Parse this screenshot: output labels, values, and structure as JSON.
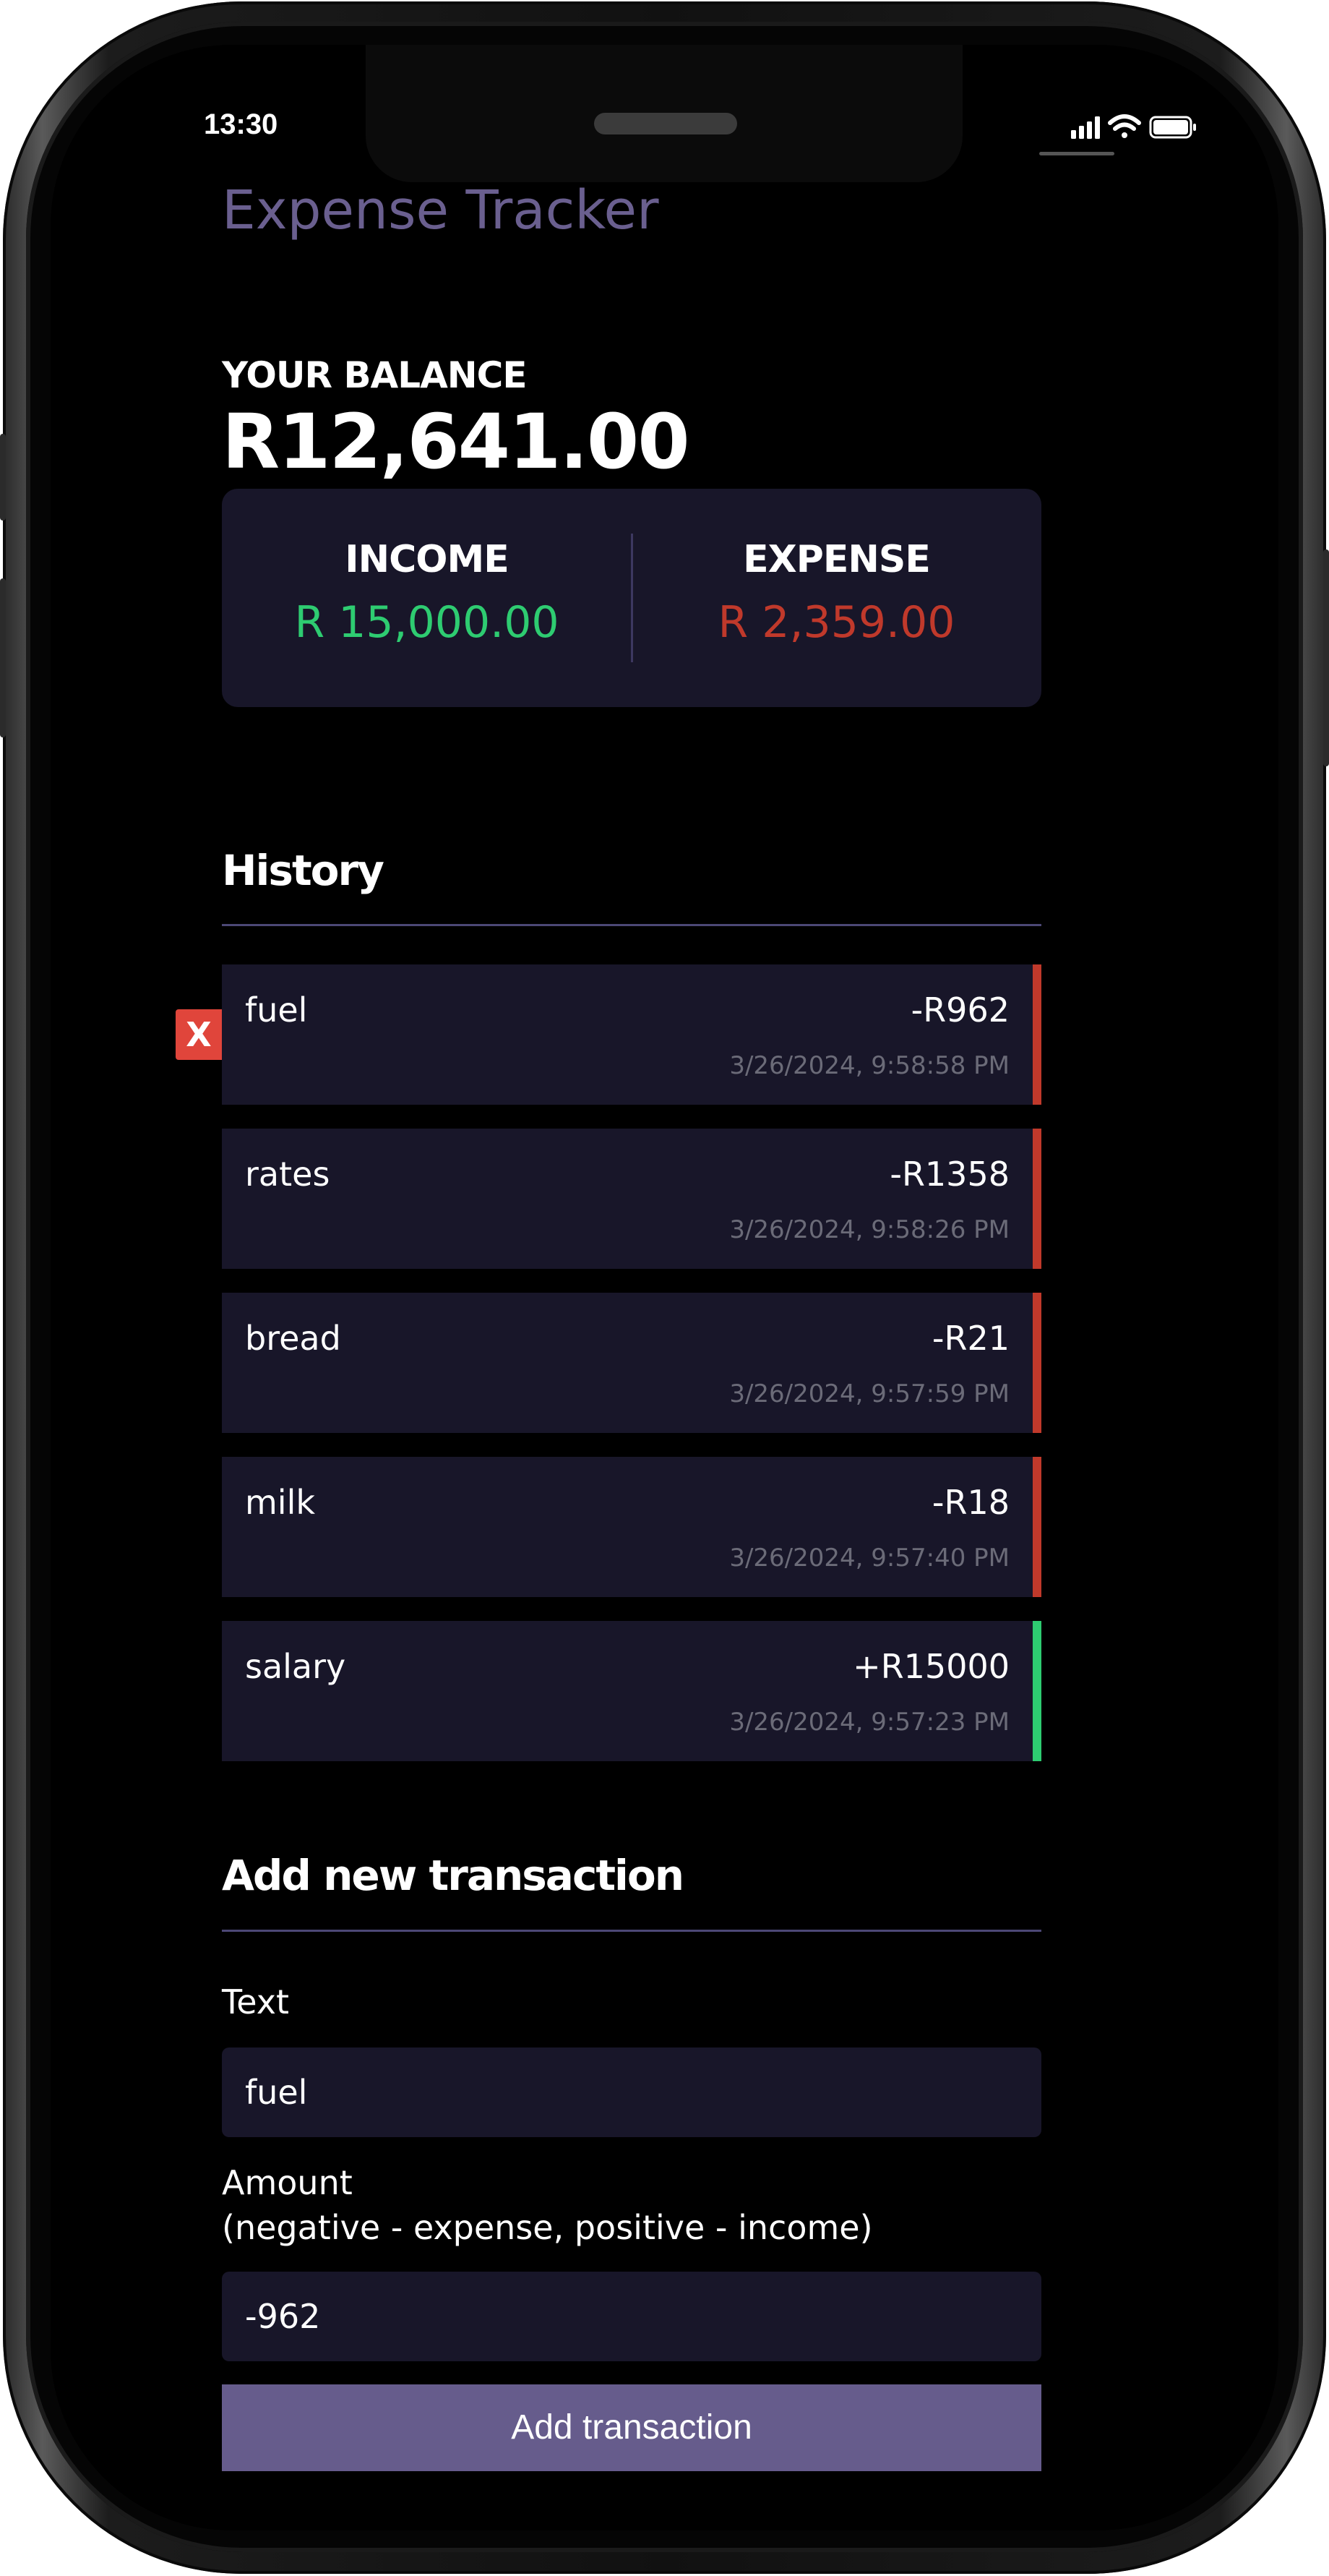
{
  "status_bar": {
    "time": "13:30"
  },
  "app": {
    "title": "Expense Tracker"
  },
  "balance": {
    "label": "YOUR BALANCE",
    "value": "R12,641.00"
  },
  "summary": {
    "income_label": "INCOME",
    "income_value": "R 15,000.00",
    "expense_label": "EXPENSE",
    "expense_value": "R 2,359.00"
  },
  "colors": {
    "income": "#2ecc71",
    "expense": "#c0392b",
    "accent": "#665c8c",
    "delete": "#e0453b"
  },
  "history": {
    "title": "History",
    "delete_label": "X",
    "transactions": [
      {
        "text": "fuel",
        "amount": "-R962",
        "date": "3/26/2024, 9:58:58 PM",
        "type": "expense"
      },
      {
        "text": "rates",
        "amount": "-R1358",
        "date": "3/26/2024, 9:58:26 PM",
        "type": "expense"
      },
      {
        "text": "bread",
        "amount": "-R21",
        "date": "3/26/2024, 9:57:59 PM",
        "type": "expense"
      },
      {
        "text": "milk",
        "amount": "-R18",
        "date": "3/26/2024, 9:57:40 PM",
        "type": "expense"
      },
      {
        "text": "salary",
        "amount": "+R15000",
        "date": "3/26/2024, 9:57:23 PM",
        "type": "income"
      }
    ]
  },
  "form": {
    "title": "Add new transaction",
    "text_label": "Text",
    "text_value": "fuel",
    "amount_label_line1": "Amount",
    "amount_label_line2": "(negative - expense, positive - income)",
    "amount_value": "-962",
    "submit_label": "Add transaction"
  }
}
